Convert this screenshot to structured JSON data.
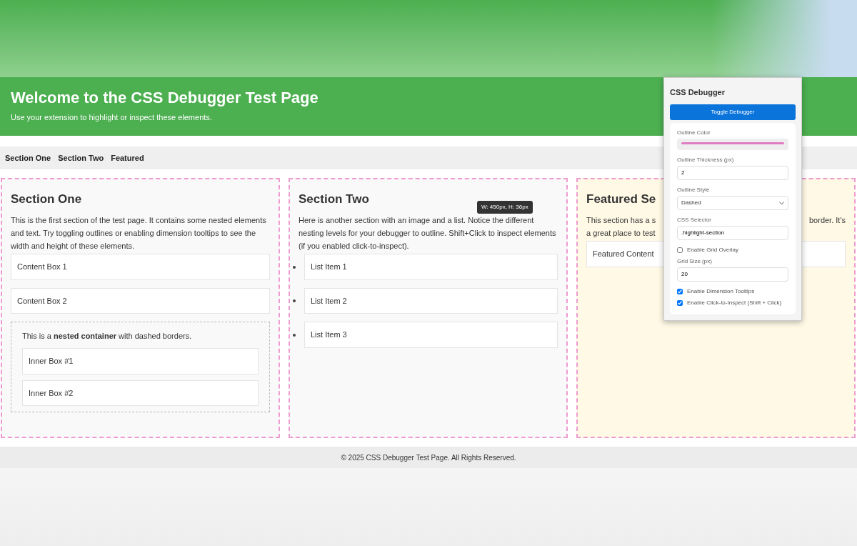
{
  "header": {
    "title": "Welcome to the CSS Debugger Test Page",
    "subtitle": "Use your extension to highlight or inspect these elements."
  },
  "nav": [
    "Section One",
    "Section Two",
    "Featured"
  ],
  "sections": [
    {
      "kind": "boxes",
      "title": "Section One",
      "text": "This is the first section of the test page. It contains some nested elements and text. Try toggling outlines or enabling dimension tooltips to see the width and height of these elements.",
      "boxes": [
        "Content Box 1",
        "Content Box 2"
      ],
      "nested": {
        "text": "This is a **nested container** with dashed borders.",
        "boxes": [
          "Inner Box #1",
          "Inner Box #2"
        ]
      }
    },
    {
      "kind": "list",
      "title": "Section Two",
      "text": "Here is another section with an image and a list. Notice the different nesting levels for your debugger to outline. Shift+Click to inspect elements (if you enabled click-to-inspect).",
      "items": [
        "List Item 1",
        "List Item 2",
        "List Item 3"
      ],
      "tooltip": "W: 450px, H: 36px"
    },
    {
      "kind": "featured",
      "title": "Featured Se",
      "text_left": "This section has a s",
      "text_right": "border. It's",
      "text_line2": "a great place to test",
      "boxes": [
        "Featured Content"
      ]
    }
  ],
  "footer": "© 2025 CSS Debugger Test Page. All Rights Reserved.",
  "popup": {
    "title": "CSS Debugger",
    "button": "Toggle Debugger",
    "fields": [
      {
        "kind": "color",
        "label": "Outline Color",
        "color": "#e07cc4"
      },
      {
        "kind": "text",
        "label": "Outline Thickness (px)",
        "value": "2"
      },
      {
        "kind": "select",
        "label": "Outline Style",
        "value": "Dashed"
      },
      {
        "kind": "text",
        "label": "CSS Selector",
        "value": ".highlight-section"
      },
      {
        "kind": "check",
        "label": "Enable Grid Overlay",
        "checked": false
      },
      {
        "kind": "text",
        "label": "Grid Size (px)",
        "value": "20"
      },
      {
        "kind": "check",
        "label": "Enable Dimension Tooltips",
        "checked": true
      },
      {
        "kind": "check",
        "label": "Enable Click-to-Inspect (Shift + Click)",
        "checked": true
      }
    ]
  }
}
